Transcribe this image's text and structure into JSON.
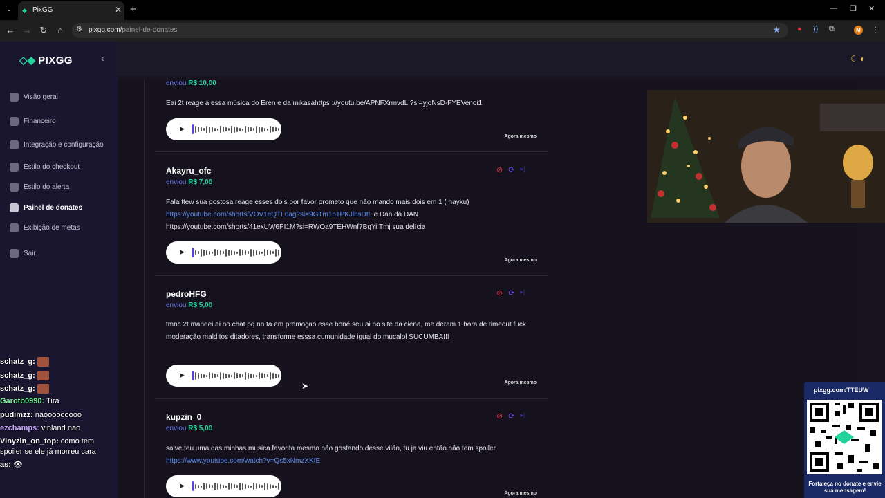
{
  "browser": {
    "tab_title": "PixGG",
    "url_host": "pixgg.com/",
    "url_path": "painel-de-donates",
    "profile_initial": "M"
  },
  "sidebar": {
    "logo": "PIXGG",
    "items": [
      {
        "label": "Visão geral",
        "icon": "home-icon"
      },
      {
        "label": "Financeiro",
        "icon": "wallet-icon"
      },
      {
        "label": "Integração e configuração",
        "icon": "settings-icon"
      },
      {
        "label": "Estilo do checkout",
        "icon": "palette-icon"
      },
      {
        "label": "Estilo do alerta",
        "icon": "palette-icon"
      },
      {
        "label": "Painel de donates",
        "icon": "donate-icon"
      },
      {
        "label": "Exibição de metas",
        "icon": "star-icon"
      },
      {
        "label": "Sair",
        "icon": "logout-icon"
      }
    ]
  },
  "chat": [
    {
      "user": "schatz_g:",
      "text": "",
      "color": "#ffffff",
      "emote": true
    },
    {
      "user": "schatz_g:",
      "text": "",
      "color": "#ffffff",
      "emote": true
    },
    {
      "user": "schatz_g:",
      "text": "",
      "color": "#ffffff",
      "emote": true
    },
    {
      "user": "Garoto0990:",
      "text": " Tira",
      "color": "#7ef0a0",
      "emote": false
    },
    {
      "user": "pudimzz:",
      "text": " naooooooooo",
      "color": "#ffffff",
      "emote": false
    },
    {
      "user": "ezchamps:",
      "text": " vinland nao",
      "color": "#c8a8ff",
      "emote": false
    },
    {
      "user": "Vinyzin_on_top:",
      "text": " como tem",
      "color": "#ffffff",
      "emote": false
    },
    {
      "user": "",
      "text": "spoiler se ele já morreu cara",
      "color": "#ffffff",
      "emote": false
    },
    {
      "user": "as:",
      "text": " 👁",
      "color": "#ffffff",
      "emote": false
    }
  ],
  "donates": [
    {
      "name": "",
      "sent_label": "enviou",
      "amount": "R$ 10,00",
      "message": "Eai 2t reage a essa música do Eren e da mikasahttps ://youtu.be/APNFXrmvdLI?si=yjoNsD-FYEVenoi1",
      "link": "",
      "message_after": "",
      "time": "Agora mesmo"
    },
    {
      "name": "Akayru_ofc",
      "sent_label": "enviou",
      "amount": "R$ 7,00",
      "message": "Fala ttew sua gostosa reage esses dois por favor prometo que não mando mais dois em 1 ( hayku)",
      "link": "https://youtube.com/shorts/VOV1eQTL6ag?si=9GTm1n1PKJlhsDtL",
      "message_after": " e Dan da DAN https://youtube.com/shorts/41exUW6PI1M?si=RWOa9TEHWnf7BgYi Tmj sua delícia",
      "time": "Agora mesmo"
    },
    {
      "name": "pedroHFG",
      "sent_label": "enviou",
      "amount": "R$ 5,00",
      "message": "tmnc 2t mandei ai no chat pq nn ta em promoçao esse boné seu ai no site da ciena, me deram 1 hora de timeout fuck moderação malditos ditadores, transforme esssa cumunidade igual do mucalol SUCUMBA!!!",
      "link": "",
      "message_after": "",
      "time": "Agora mesmo"
    },
    {
      "name": "kupzin_0",
      "sent_label": "enviou",
      "amount": "R$ 5,00",
      "message": "salve teu uma das minhas musica favorita mesmo não gostando desse vilão, tu ja viu então não tem spoiler ",
      "link": "https://www.youtube.com/watch?v=Qs5xNmzXKfE",
      "message_after": "",
      "time": "Agora mesmo"
    }
  ],
  "qr": {
    "url": "pixgg.com/TTEUW",
    "caption": "Fortaleça no donate e envie sua mensagem!"
  },
  "colors": {
    "accent": "#24d39b",
    "link": "#5b8cf3",
    "sent": "#6c79f0",
    "block": "#e02d3c",
    "sidebar": "#1a1630"
  }
}
